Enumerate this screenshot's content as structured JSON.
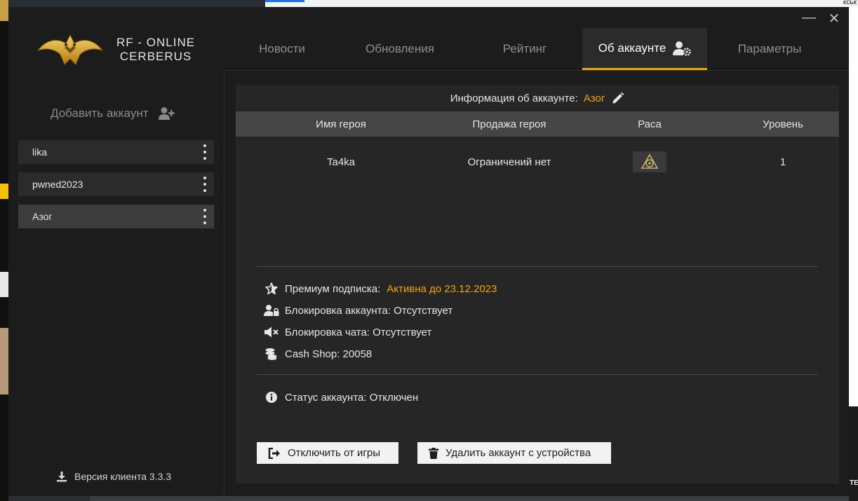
{
  "window": {
    "brand_line1": "RF - ONLINE",
    "brand_line2": "CERBERUS",
    "minimize_glyph": "—",
    "close_glyph": "✕"
  },
  "nav": {
    "tabs": [
      {
        "label": "Новости",
        "active": false
      },
      {
        "label": "Обновления",
        "active": false
      },
      {
        "label": "Рейтинг",
        "active": false
      },
      {
        "label": "Об аккаунте",
        "active": true,
        "icon": "user-gear-icon"
      },
      {
        "label": "Параметры",
        "active": false
      }
    ]
  },
  "sidebar": {
    "add_account_label": "Добавить аккаунт",
    "accounts": [
      {
        "name": "lika",
        "active": false
      },
      {
        "name": "pwned2023",
        "active": false
      },
      {
        "name": "Азог",
        "active": true
      }
    ],
    "version_label": "Версия клиента 3.3.3"
  },
  "panel": {
    "title": "Информация об аккаунте:",
    "account_name": "Азог",
    "table": {
      "headers": [
        "Имя героя",
        "Продажа героя",
        "Раса",
        "Уровень"
      ],
      "rows": [
        {
          "hero_name": "Ta4ka",
          "sale": "Ограничений нет",
          "race_icon": "race-emblem-icon",
          "level": "1"
        }
      ]
    },
    "premium_label": "Премиум подписка:",
    "premium_value": "Активна до 23.12.2023",
    "account_block": "Блокировка аккаунта: Отсутствует",
    "chat_block": "Блокировка чата: Отсутствует",
    "cash_shop": "Cash Shop: 20058",
    "status": "Статус аккаунта: Отключен",
    "disconnect_button": "Отключить от игры",
    "delete_button": "Удалить аккаунт с устройства"
  },
  "colors": {
    "accent": "#f0a500",
    "window_bg": "#1c1c1c",
    "panel_bg": "#262626",
    "table_head_bg": "#454545"
  },
  "background": {
    "top_right_fragment": "кськ",
    "right_edge_fragment": "TE"
  }
}
